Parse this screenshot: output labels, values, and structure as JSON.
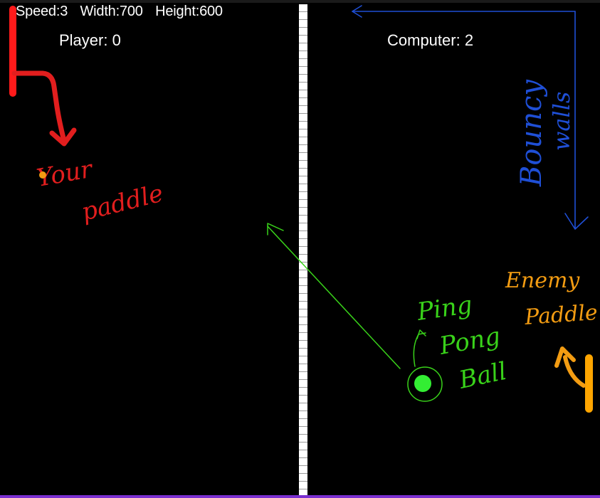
{
  "stats": {
    "speed": "Speed:3",
    "width": "Width:700",
    "height": "Height:600"
  },
  "scores": {
    "player": "Player: 0",
    "computer": "Computer: 2"
  },
  "annotations": {
    "player_paddle_line1": "Your",
    "player_paddle_line2": "paddle",
    "walls_line1": "Bouncy",
    "walls_line2": "walls",
    "ball_line1": "Ping",
    "ball_line2": "Pong",
    "ball_line3": "Ball",
    "enemy_line1": "Enemy",
    "enemy_line2": "Paddle"
  },
  "colors": {
    "background": "#000000",
    "player_paddle": "#ff1a1a",
    "enemy_paddle": "#ffa500",
    "ball": "#33ee33",
    "net": "#ffffff",
    "annotation_red": "#e21e1e",
    "annotation_blue": "#1f4fd6",
    "annotation_green": "#39d21a",
    "annotation_orange": "#f39c12"
  }
}
